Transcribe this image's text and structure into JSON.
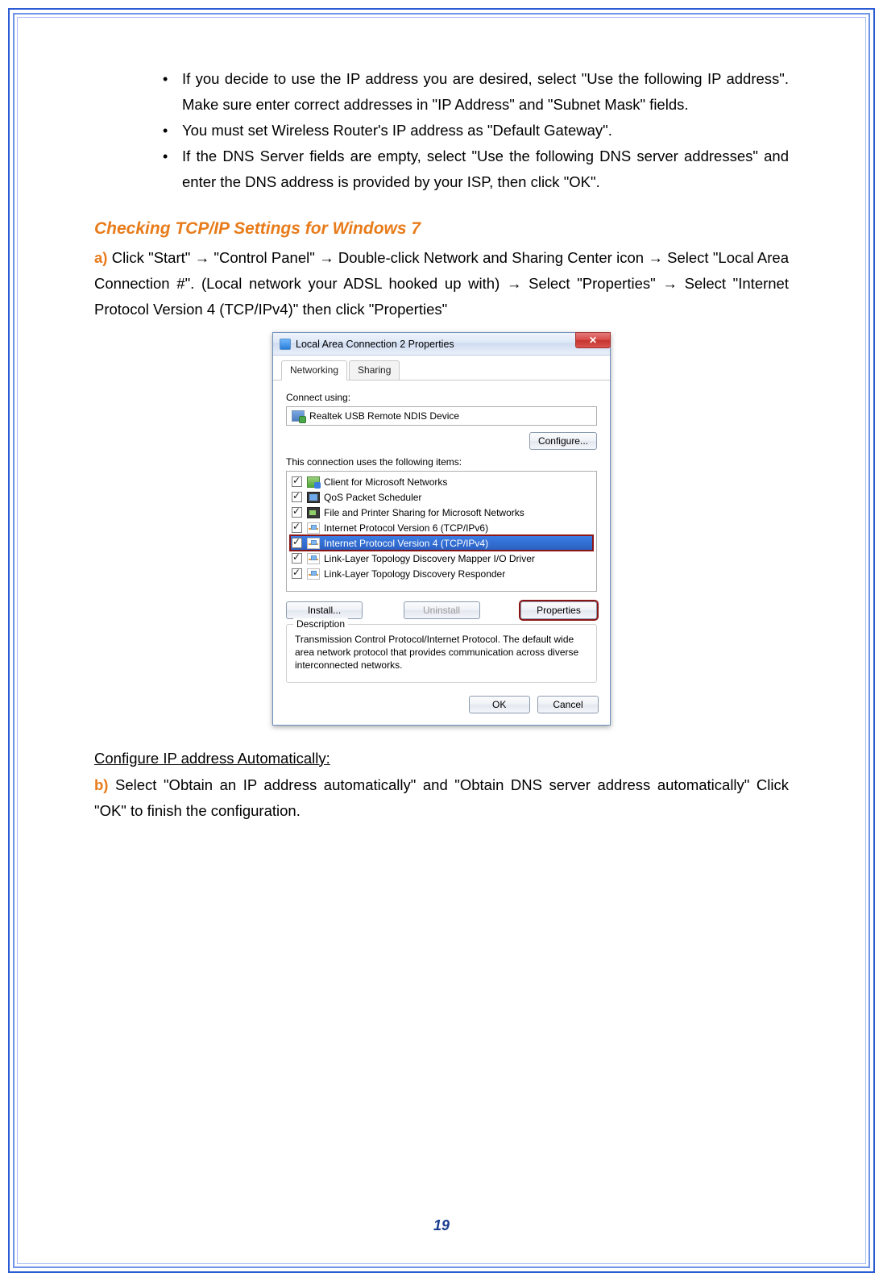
{
  "bullets": [
    "If you decide to use the IP address you are desired, select \"Use the following IP address\". Make sure enter correct addresses in \"IP Address\" and \"Subnet Mask\" fields.",
    "You must set Wireless Router's IP address as \"Default Gateway\".",
    "If the DNS Server fields are empty, select \"Use the following DNS server addresses\" and enter the DNS address is provided by your ISP, then click \"OK\"."
  ],
  "section_heading": "Checking TCP/IP Settings for Windows 7",
  "step_a": {
    "label": "a)",
    "text": " Click \"Start\" → \"Control Panel\" → Double-click Network and Sharing Center icon → Select \"Local Area Connection #\". (Local network your ADSL hooked up with) → Select \"Properties\" → Select \"Internet Protocol Version 4 (TCP/IPv4)\" then click \"Properties\""
  },
  "dialog": {
    "title": "Local Area Connection 2 Properties",
    "close_glyph": "✕",
    "tabs": {
      "networking": "Networking",
      "sharing": "Sharing"
    },
    "connect_using_label": "Connect using:",
    "adapter_name": "Realtek USB Remote NDIS Device",
    "configure_btn": "Configure...",
    "items_label": "This connection uses the following items:",
    "items": [
      {
        "checked": true,
        "label": "Client for Microsoft Networks",
        "icon": "ic-client"
      },
      {
        "checked": true,
        "label": "QoS Packet Scheduler",
        "icon": "ic-qos"
      },
      {
        "checked": true,
        "label": "File and Printer Sharing for Microsoft Networks",
        "icon": "ic-fps"
      },
      {
        "checked": true,
        "label": "Internet Protocol Version 6 (TCP/IPv6)",
        "icon": "ic-net"
      },
      {
        "checked": true,
        "label": "Internet Protocol Version 4 (TCP/IPv4)",
        "icon": "ic-net",
        "selected": true
      },
      {
        "checked": true,
        "label": "Link-Layer Topology Discovery Mapper I/O Driver",
        "icon": "ic-net"
      },
      {
        "checked": true,
        "label": "Link-Layer Topology Discovery Responder",
        "icon": "ic-net"
      }
    ],
    "install_btn": "Install...",
    "uninstall_btn": "Uninstall",
    "properties_btn": "Properties",
    "desc_legend": "Description",
    "desc_text": "Transmission Control Protocol/Internet Protocol. The default wide area network protocol that provides communication across diverse interconnected networks.",
    "ok_btn": "OK",
    "cancel_btn": "Cancel"
  },
  "subheading": "Configure IP address Automatically:",
  "step_b": {
    "label": "b)",
    "text": " Select \"Obtain an IP address automatically\" and \"Obtain DNS server address automatically\" Click \"OK\" to finish the configuration."
  },
  "page_number": "19"
}
